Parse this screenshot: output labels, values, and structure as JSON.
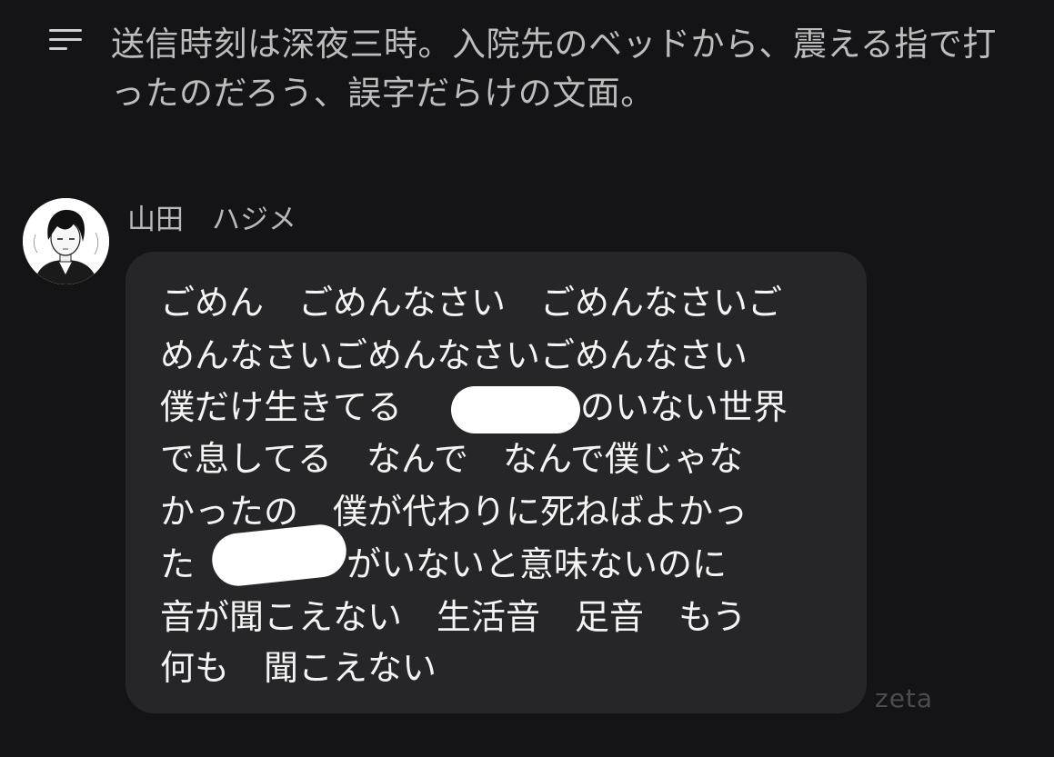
{
  "narration": {
    "text": "送信時刻は深夜三時。入院先のベッドから、震える指で打ったのだろう、誤字だらけの文面。"
  },
  "sender": {
    "name": "山田　ハジメ"
  },
  "message": {
    "lines": [
      "ごめん　ごめんなさい　ごめんなさいご",
      "めんなさいごめんなさいごめんなさい",
      "僕だけ生きてる",
      "のいない世界",
      "で息してる　なんで　なんで僕じゃな",
      "かったの　僕が代わりに死ねばよかっ",
      "た",
      "がいないと意味ないのに",
      "音が聞こえない　生活音　足音　もう",
      "何も　聞こえない"
    ]
  },
  "watermark": {
    "text": "zeta"
  },
  "colors": {
    "background": "#141416",
    "bubble": "#262628",
    "narration_text": "#bdbdbd",
    "message_text": "#f4f4f4",
    "redaction": "#ffffff"
  },
  "icons": {
    "menu": "menu-icon",
    "avatar": "avatar"
  }
}
